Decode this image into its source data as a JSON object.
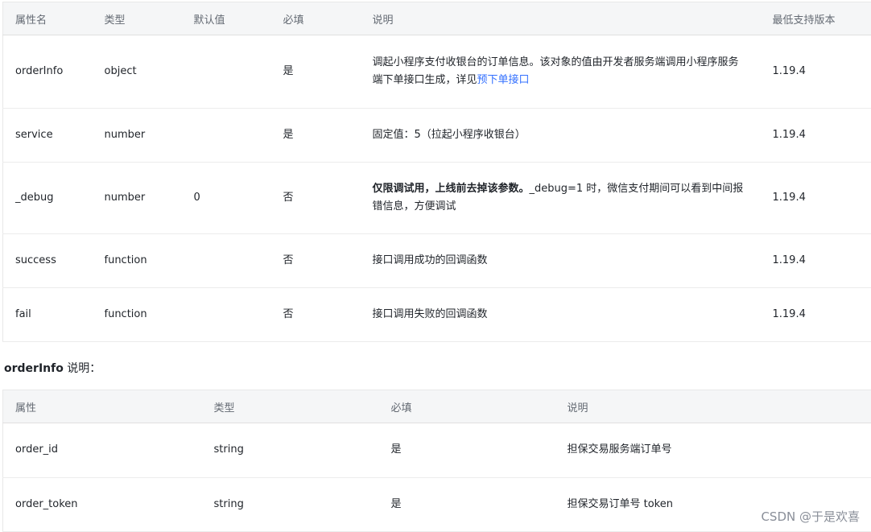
{
  "table1": {
    "headers": [
      "属性名",
      "类型",
      "默认值",
      "必填",
      "说明",
      "最低支持版本"
    ],
    "rows": [
      {
        "name": "orderInfo",
        "type": "object",
        "default": "",
        "required": "是",
        "desc_text": "调起小程序支付收银台的订单信息。该对象的值由开发者服务端调用小程序服务端下单接口生成，详见",
        "desc_link": "预下单接口",
        "version": "1.19.4"
      },
      {
        "name": "service",
        "type": "number",
        "default": "",
        "required": "是",
        "desc_text": "固定值：5（拉起小程序收银台）",
        "version": "1.19.4"
      },
      {
        "name": "_debug",
        "type": "number",
        "default": "0",
        "required": "否",
        "desc_bold": "仅限调试用，上线前去掉该参数。",
        "desc_text": "_debug=1 时，微信支付期间可以看到中间报错信息，方便调试",
        "version": "1.19.4"
      },
      {
        "name": "success",
        "type": "function",
        "default": "",
        "required": "否",
        "desc_text": "接口调用成功的回调函数",
        "version": "1.19.4"
      },
      {
        "name": "fail",
        "type": "function",
        "default": "",
        "required": "否",
        "desc_text": "接口调用失败的回调函数",
        "version": "1.19.4"
      }
    ]
  },
  "section": {
    "bold": "orderInfo",
    "rest": " 说明："
  },
  "table2": {
    "headers": [
      "属性",
      "类型",
      "必填",
      "说明"
    ],
    "rows": [
      {
        "name": "order_id",
        "type": "string",
        "required": "是",
        "desc": "担保交易服务端订单号"
      },
      {
        "name": "order_token",
        "type": "string",
        "required": "是",
        "desc": "担保交易订单号 token"
      }
    ]
  },
  "watermark": "CSDN @于是欢喜"
}
